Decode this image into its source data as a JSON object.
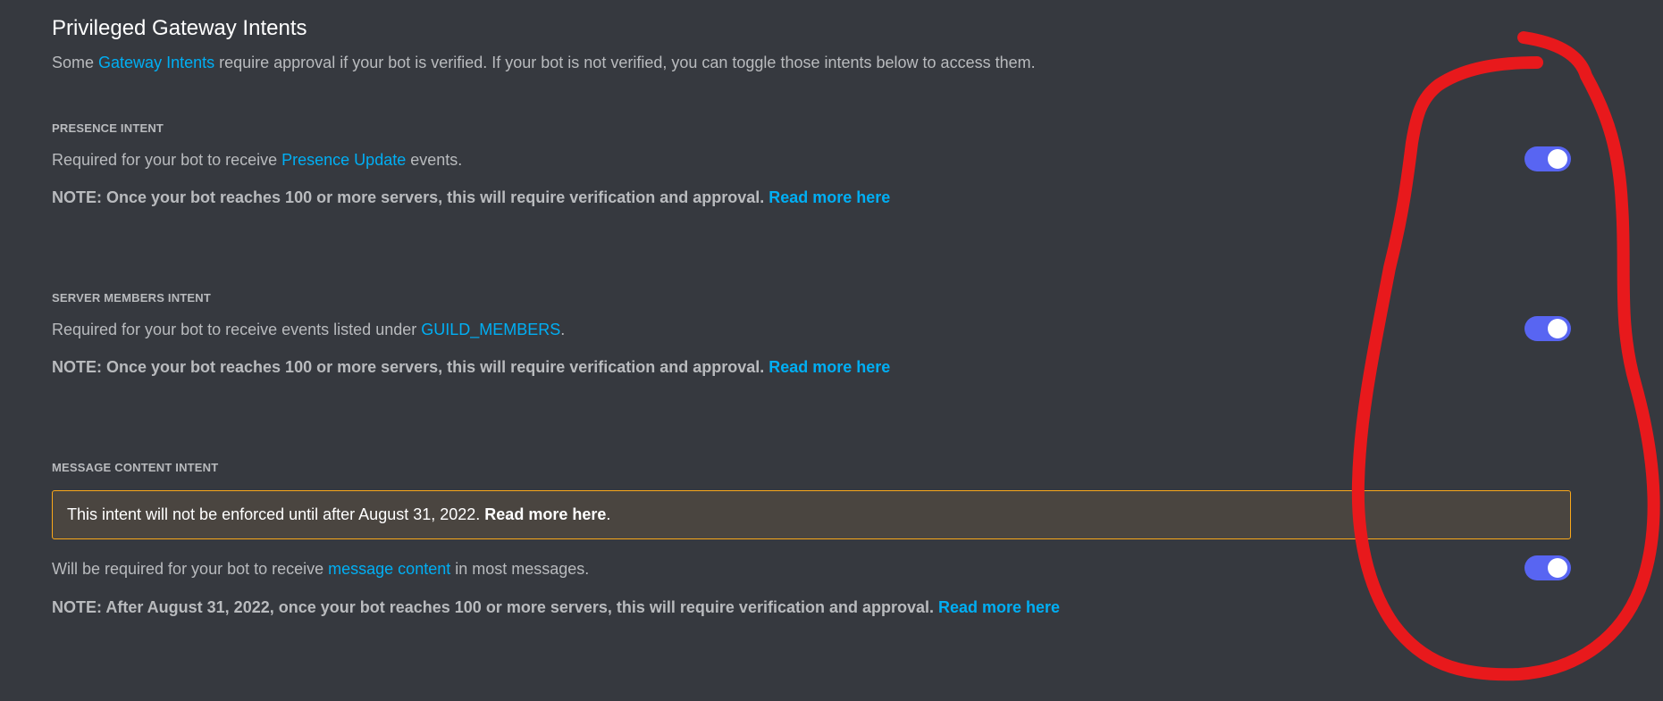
{
  "header": {
    "title": "Privileged Gateway Intents",
    "desc_before": "Some ",
    "desc_link": "Gateway Intents",
    "desc_after": " require approval if your bot is verified. If your bot is not verified, you can toggle those intents below to access them."
  },
  "intents": [
    {
      "heading": "PRESENCE INTENT",
      "text_before": "Required for your bot to receive ",
      "text_link": "Presence Update",
      "text_after": " events.",
      "note": "NOTE: Once your bot reaches 100 or more servers, this will require verification and approval. ",
      "note_link": "Read more here",
      "enabled": true
    },
    {
      "heading": "SERVER MEMBERS INTENT",
      "text_before": "Required for your bot to receive events listed under ",
      "text_link": "GUILD_MEMBERS",
      "text_after": ".",
      "note": "NOTE: Once your bot reaches 100 or more servers, this will require verification and approval. ",
      "note_link": "Read more here",
      "enabled": true
    },
    {
      "heading": "MESSAGE CONTENT INTENT",
      "notice_text": "This intent will not be enforced until after August 31, 2022. ",
      "notice_bold": "Read more here",
      "notice_end": ".",
      "text_before": "Will be required for your bot to receive ",
      "text_link": "message content",
      "text_after": " in most messages.",
      "note": "NOTE: After August 31, 2022, once your bot reaches 100 or more servers, this will require verification and approval. ",
      "note_link": "Read more here",
      "enabled": true
    }
  ],
  "colors": {
    "background": "#36393f",
    "link": "#00aff4",
    "toggle_on": "#5865f2",
    "notice_border": "#faa81a",
    "annotation": "#e8191c"
  }
}
